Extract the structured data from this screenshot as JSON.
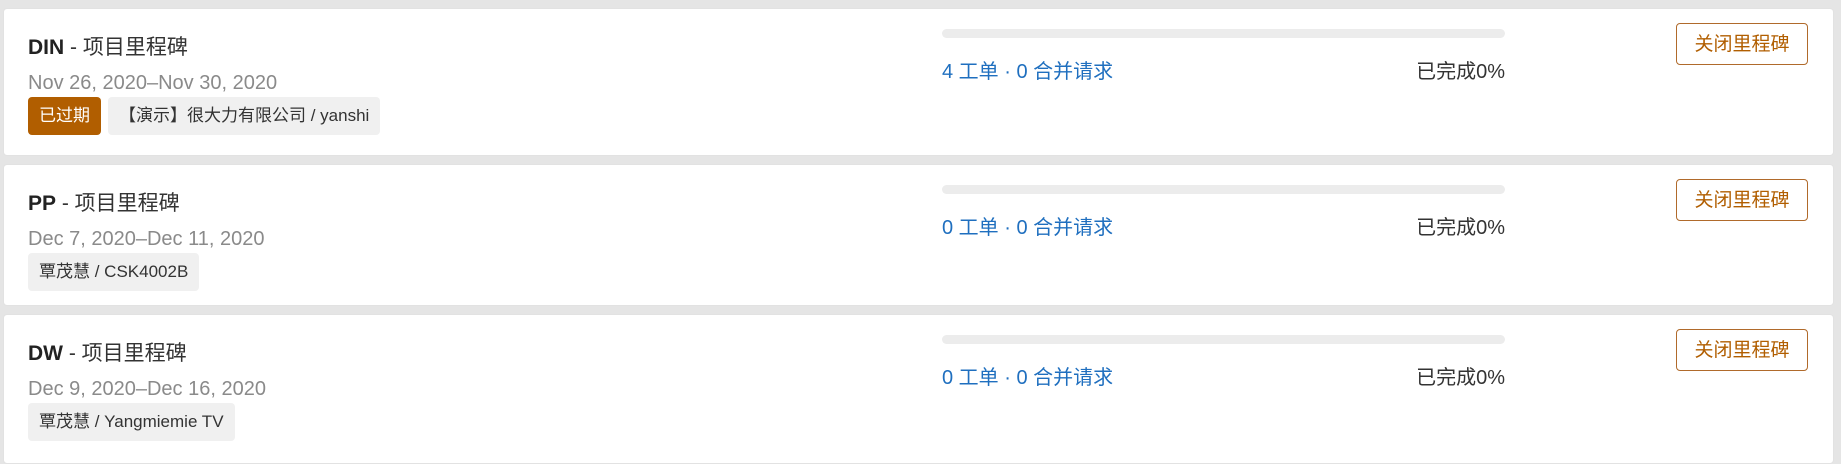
{
  "milestones": [
    {
      "code": "DIN",
      "suffix": " - 项目里程碑",
      "dates": "Nov 26, 2020–Nov 30, 2020",
      "expired_label": "已过期",
      "project": "【演示】很大力有限公司 / yanshi",
      "issues_mrs": "4 工单 · 0 合并请求",
      "completed": "已完成0%",
      "progress_fraction": 0,
      "close_label": "关闭里程碑"
    },
    {
      "code": "PP",
      "suffix": " - 项目里程碑",
      "dates": "Dec 7, 2020–Dec 11, 2020",
      "project": "覃茂慧 / CSK4002B",
      "issues_mrs": "0 工单 · 0 合并请求",
      "completed": "已完成0%",
      "progress_fraction": 0,
      "close_label": "关闭里程碑"
    },
    {
      "code": "DW",
      "suffix": " - 项目里程碑",
      "dates": "Dec 9, 2020–Dec 16, 2020",
      "project": "覃茂慧 / Yangmiemie TV",
      "issues_mrs": "0 工单 · 0 合并请求",
      "completed": "已完成0%",
      "progress_fraction": 0,
      "close_label": "关闭里程碑"
    }
  ],
  "colors": {
    "link_blue": "#1f6fbf",
    "expired_badge": "#b15e00",
    "close_button_text": "#b15e00"
  }
}
